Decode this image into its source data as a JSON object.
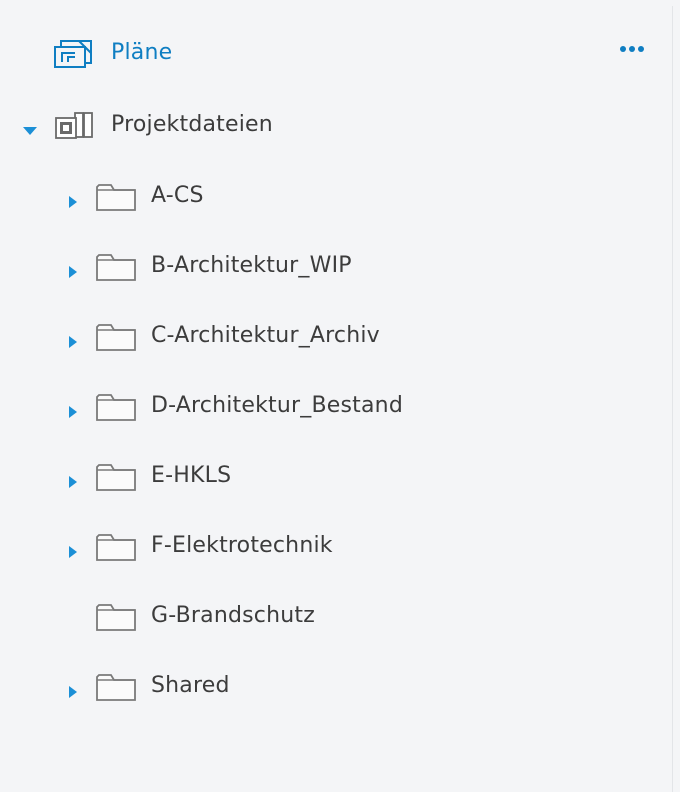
{
  "plans": {
    "label": "Pläne",
    "icon": "sheets-icon",
    "more_icon": "more-horizontal-icon"
  },
  "project_files": {
    "label": "Projektdateien",
    "icon": "project-files-icon",
    "expanded": true
  },
  "folders": [
    {
      "label": "A-CS",
      "has_children": true
    },
    {
      "label": "B-Architektur_WIP",
      "has_children": true
    },
    {
      "label": "C-Architektur_Archiv",
      "has_children": true
    },
    {
      "label": "D-Architektur_Bestand",
      "has_children": true
    },
    {
      "label": "E-HKLS",
      "has_children": true
    },
    {
      "label": "F-Elektrotechnik",
      "has_children": true
    },
    {
      "label": "G-Brandschutz",
      "has_children": false
    },
    {
      "label": "Shared",
      "has_children": true
    }
  ],
  "colors": {
    "accent": "#0f7ec2",
    "caret": "#1b8fd6",
    "text": "#3c3c3c",
    "background": "#f4f5f7"
  }
}
